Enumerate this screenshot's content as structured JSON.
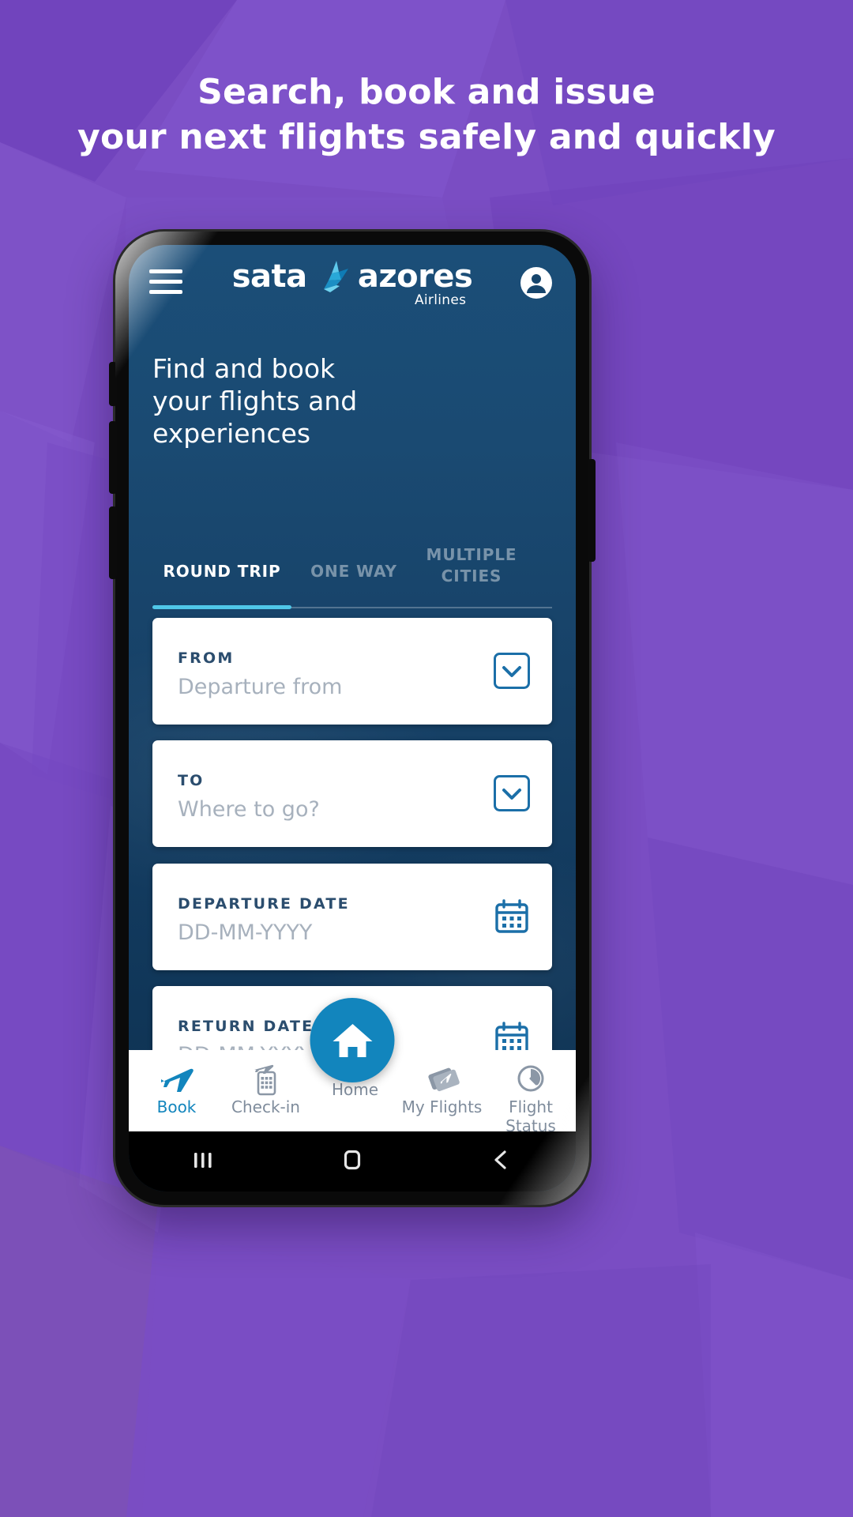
{
  "promo": {
    "headline_line1": "Search, book and issue",
    "headline_line2": "your next flights safely and quickly",
    "background_color": "#7a4dc3",
    "text_color": "#ffffff"
  },
  "app": {
    "brand": {
      "word1": "sata",
      "word2": "azores",
      "subtitle": "Airlines",
      "bird_icon": "bird-icon",
      "accent_color": "#4fc7e8"
    },
    "header": {
      "menu_icon": "hamburger-menu-icon",
      "account_icon": "account-circle-icon"
    },
    "hero": {
      "line1": "Find and book",
      "line2": "your flights and",
      "line3": "experiences"
    },
    "tabs": [
      {
        "label": "ROUND TRIP",
        "active": true
      },
      {
        "label": "ONE WAY",
        "active": false
      },
      {
        "label": "MULTIPLE CITIES",
        "active": false
      }
    ],
    "tab_indicator_color": "#4fc7e8",
    "form": [
      {
        "label": "FROM",
        "value": "Departure from",
        "icon": "chevron-down-icon"
      },
      {
        "label": "TO",
        "value": "Where to go?",
        "icon": "chevron-down-icon"
      },
      {
        "label": "DEPARTURE DATE",
        "value": "DD-MM-YYYY",
        "icon": "calendar-icon"
      },
      {
        "label": "RETURN DATE",
        "value": "DD-MM-YYYY",
        "icon": "calendar-icon"
      }
    ],
    "bottom_nav": [
      {
        "label": "Book",
        "icon": "airplane-icon",
        "active": true
      },
      {
        "label": "Check-in",
        "icon": "mobile-checkin-icon",
        "active": false
      },
      {
        "label": "Home",
        "icon": "home-icon",
        "active": false
      },
      {
        "label": "My Flights",
        "icon": "tickets-icon",
        "active": false
      },
      {
        "label": "Flight Status",
        "icon": "flight-status-icon",
        "active": false
      }
    ],
    "active_color": "#1285bd",
    "inactive_color": "#7f8c9c"
  },
  "system_nav": {
    "recents_icon": "recents-icon",
    "home_icon": "home-square-icon",
    "back_icon": "back-chevron-icon"
  }
}
